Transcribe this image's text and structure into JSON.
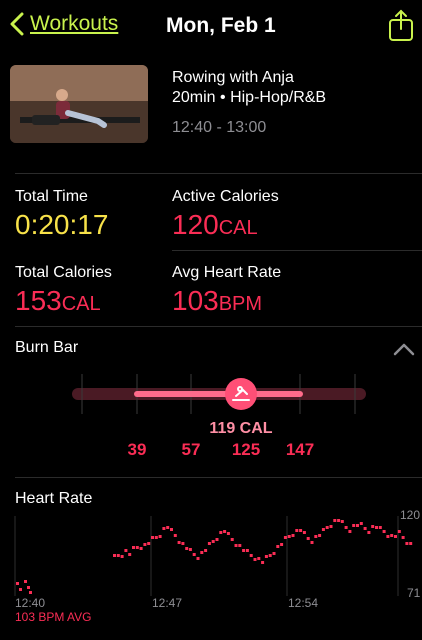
{
  "nav": {
    "back_label": "Workouts",
    "title": "Mon, Feb 1"
  },
  "workout": {
    "title": "Rowing with Anja",
    "subtitle": "20min • Hip-Hop/R&B",
    "time_range": "12:40 - 13:00"
  },
  "stats": {
    "total_time_label": "Total Time",
    "total_time": "0:20:17",
    "active_cal_label": "Active Calories",
    "active_cal_value": "120",
    "active_cal_unit": "CAL",
    "total_cal_label": "Total Calories",
    "total_cal_value": "153",
    "total_cal_unit": "CAL",
    "avg_hr_label": "Avg Heart Rate",
    "avg_hr_value": "103",
    "avg_hr_unit": "BPM"
  },
  "burn_bar": {
    "title": "Burn Bar",
    "value_label": "119 CAL",
    "ticks": [
      "39",
      "57",
      "125",
      "147"
    ]
  },
  "heart_rate": {
    "title": "Heart Rate",
    "x_ticks": [
      "12:40",
      "12:47",
      "12:54"
    ],
    "y_ticks": [
      "120",
      "71"
    ],
    "avg_label": "103 BPM AVG"
  },
  "colors": {
    "accent": "#c9f24d",
    "red": "#fa2d55",
    "yellow": "#f8e249",
    "pink": "#ff4f76"
  }
}
